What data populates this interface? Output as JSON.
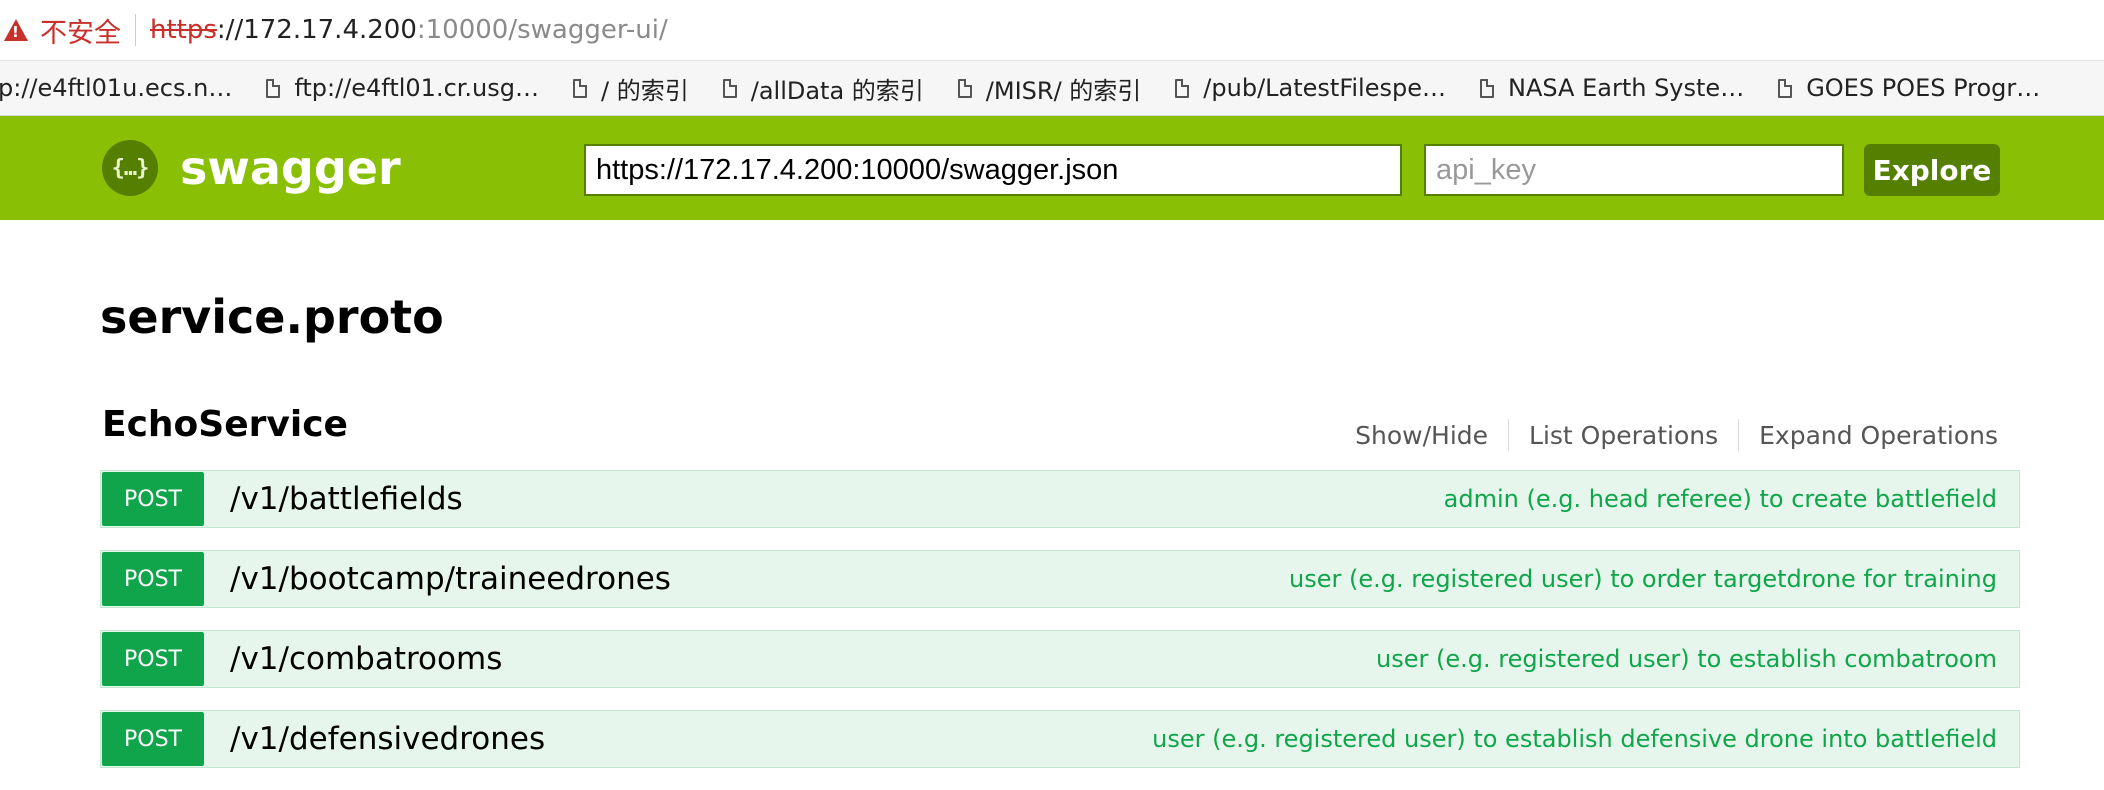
{
  "browser": {
    "insecure_label": "不安全",
    "url": {
      "scheme": "https",
      "host": "://172.17.4.200",
      "rest": ":10000/swagger-ui/"
    }
  },
  "bookmarks": [
    {
      "label": "p://e4ftl01u.ecs.n…",
      "icon": null
    },
    {
      "label": "ftp://e4ftl01.cr.usg…",
      "icon": "document-icon"
    },
    {
      "label": "/ 的索引",
      "icon": "document-icon"
    },
    {
      "label": "/allData 的索引",
      "icon": "document-icon"
    },
    {
      "label": "/MISR/ 的索引",
      "icon": "document-icon"
    },
    {
      "label": "/pub/LatestFilespe…",
      "icon": "document-icon"
    },
    {
      "label": "NASA Earth Syste…",
      "icon": "document-icon"
    },
    {
      "label": "GOES POES Progr…",
      "icon": "document-icon"
    }
  ],
  "header": {
    "logo_glyph": "{…}",
    "logo_text": "swagger",
    "url_value": "https://172.17.4.200:10000/swagger.json",
    "api_key_placeholder": "api_key",
    "explore_label": "Explore",
    "bg_color": "#89bf04",
    "accent_color": "#547f00"
  },
  "main": {
    "title": "service.proto",
    "resource": {
      "name": "EchoService",
      "options": {
        "show_hide": "Show/Hide",
        "list_operations": "List Operations",
        "expand_operations": "Expand Operations"
      },
      "operations": [
        {
          "method": "POST",
          "path": "/v1/battlefields",
          "summary": "admin (e.g. head referee) to create battlefield"
        },
        {
          "method": "POST",
          "path": "/v1/bootcamp/traineedrones",
          "summary": "user (e.g. registered user) to order targetdrone for training"
        },
        {
          "method": "POST",
          "path": "/v1/combatrooms",
          "summary": "user (e.g. registered user) to establish combatroom"
        },
        {
          "method": "POST",
          "path": "/v1/defensivedrones",
          "summary": "user (e.g. registered user) to establish defensive drone into battlefield"
        }
      ]
    },
    "post_color": "#10a54a",
    "post_bg": "#e7f6ec"
  }
}
